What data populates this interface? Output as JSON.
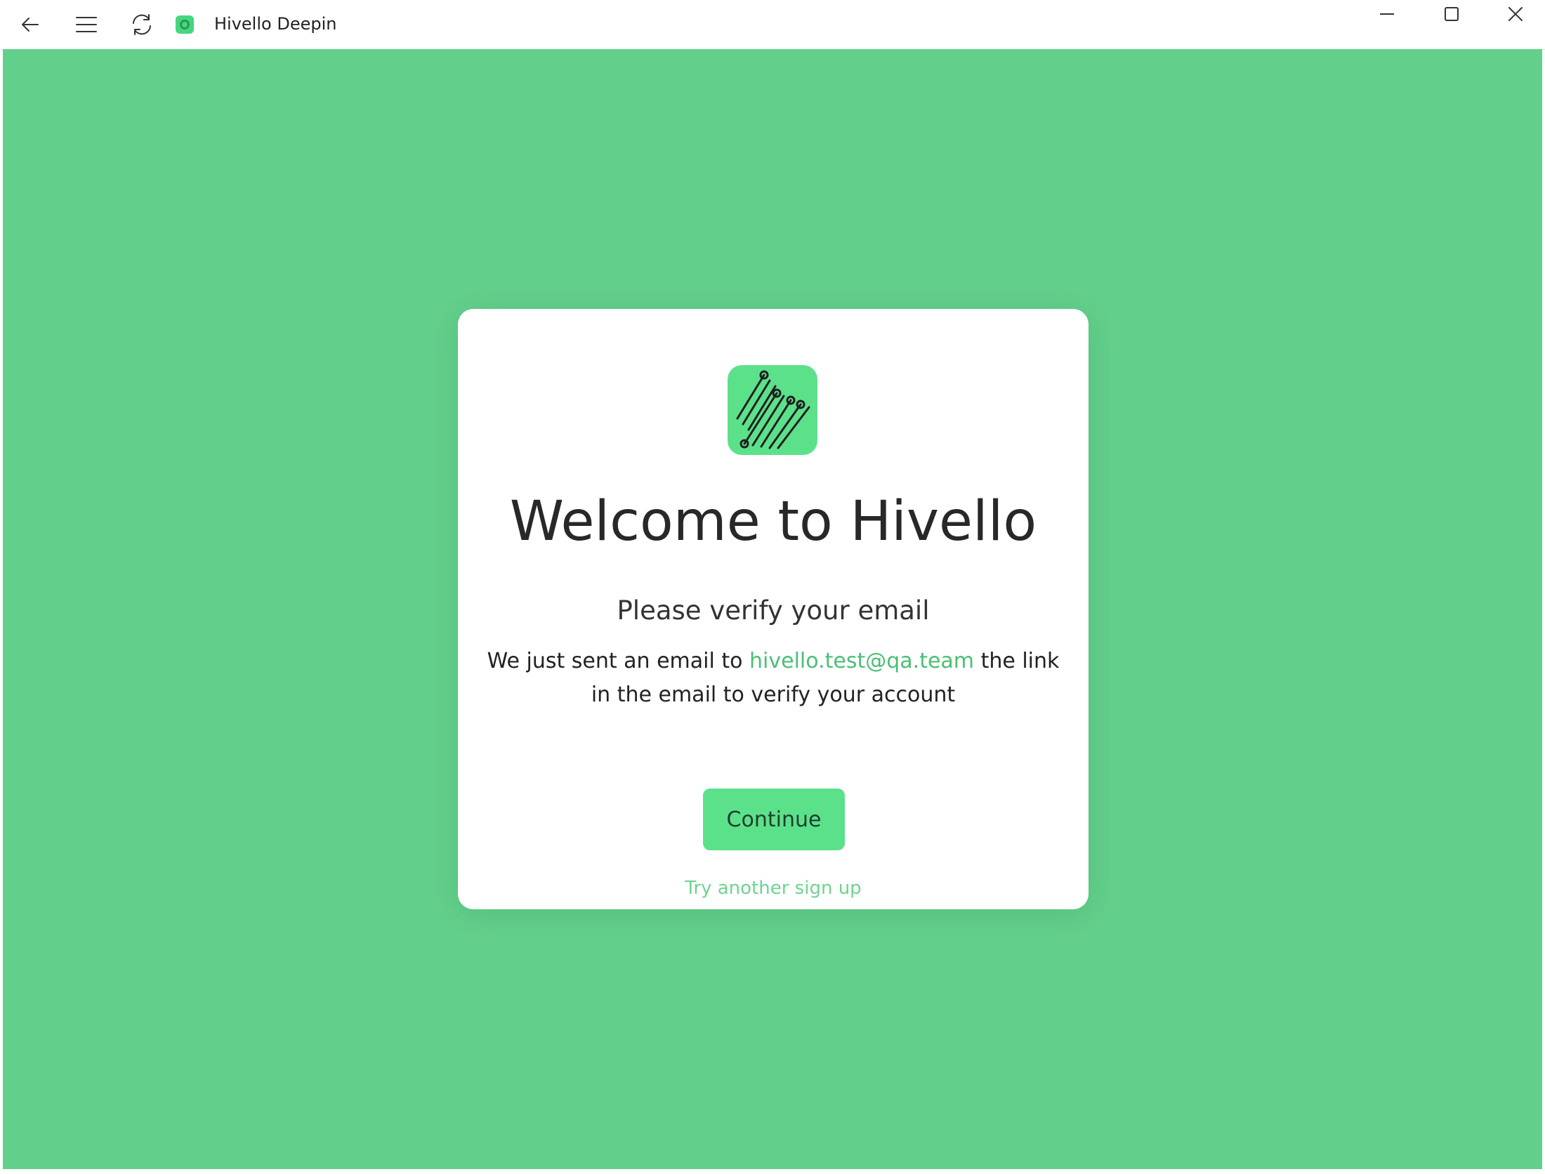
{
  "window": {
    "title": "Hivello Deepin",
    "back_icon": "arrow-left-icon",
    "menu_icon": "hamburger-menu-icon",
    "refresh_icon": "refresh-icon",
    "app_icon": "hivello-app-icon",
    "minimize_icon": "minimize-icon",
    "maximize_icon": "maximize-icon",
    "close_icon": "close-icon"
  },
  "colors": {
    "background": "#62cf8b",
    "accent": "#5ce18b",
    "link": "#4cbf76",
    "card": "#ffffff"
  },
  "card": {
    "logo_icon": "hivello-logo-icon",
    "heading": "Welcome to Hivello",
    "subheading": "Please verify your email",
    "message_prefix": "We just sent an email to ",
    "email": "hivello.test@qa.team",
    "message_suffix": " the link in the email to verify your account",
    "continue_label": "Continue",
    "alt_link_label": "Try another sign up"
  }
}
